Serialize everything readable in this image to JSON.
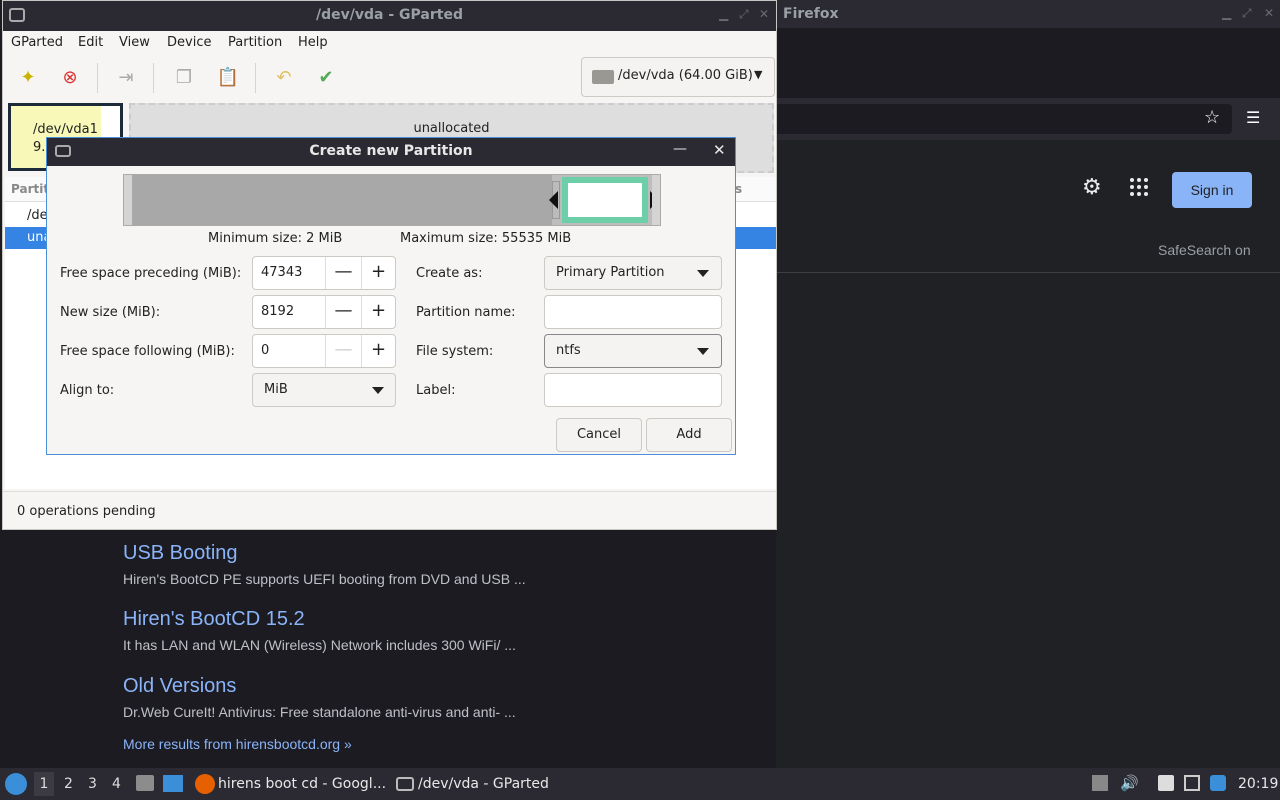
{
  "firefox": {
    "window_title": "Firefox",
    "signin_label": "Sign in",
    "safesearch_label": "SafeSearch on",
    "results": [
      {
        "title": "USB Booting",
        "snippet": "Hiren's BootCD PE supports UEFI booting from DVD and USB ..."
      },
      {
        "title": "Hiren's BootCD 15.2",
        "snippet": "It has LAN and WLAN (Wireless) Network includes 300 WiFi/ ..."
      },
      {
        "title": "Old Versions",
        "snippet": "Dr.Web CureIt! Antivirus: Free standalone anti-virus and anti- ..."
      }
    ],
    "more_results": "More results from hirensbootcd.org »"
  },
  "gparted": {
    "window_title": "/dev/vda - GParted",
    "menu": [
      "GParted",
      "Edit",
      "View",
      "Device",
      "Partition",
      "Help"
    ],
    "device": "/dev/vda (64.00 GiB)",
    "visual": {
      "partition1_name": "/dev/vda1",
      "partition1_size": "9.",
      "unallocated": "unallocated"
    },
    "list": {
      "header_partition": "Partit",
      "header_flags": "s",
      "rows": [
        "/dev",
        "una"
      ]
    },
    "status": "0 operations pending"
  },
  "dialog": {
    "title": "Create new Partition",
    "min_size": "Minimum size: 2 MiB",
    "max_size": "Maximum size: 55535 MiB",
    "free_preceding": {
      "label": "Free space preceding (MiB):",
      "value": "47343"
    },
    "new_size": {
      "label": "New size (MiB):",
      "value": "8192"
    },
    "free_following": {
      "label": "Free space following (MiB):",
      "value": "0"
    },
    "align_to": {
      "label": "Align to:",
      "value": "MiB"
    },
    "create_as": {
      "label": "Create as:",
      "value": "Primary Partition"
    },
    "partition_name": {
      "label": "Partition name:",
      "value": ""
    },
    "file_system": {
      "label": "File system:",
      "value": "ntfs"
    },
    "fs_label": {
      "label": "Label:",
      "value": ""
    },
    "cancel_label": "Cancel",
    "add_label": "Add",
    "minus_glyph": "—",
    "plus_glyph": "+"
  },
  "taskbar": {
    "workspaces": [
      "1",
      "2",
      "3",
      "4"
    ],
    "firefox_task": "hirens boot cd - Googl...",
    "gparted_task": "/dev/vda - GParted",
    "clock": "20:19"
  },
  "colors": {
    "accent": "#3584e4",
    "new_partition": "#6ccfa8",
    "link": "#8ab4f8"
  }
}
